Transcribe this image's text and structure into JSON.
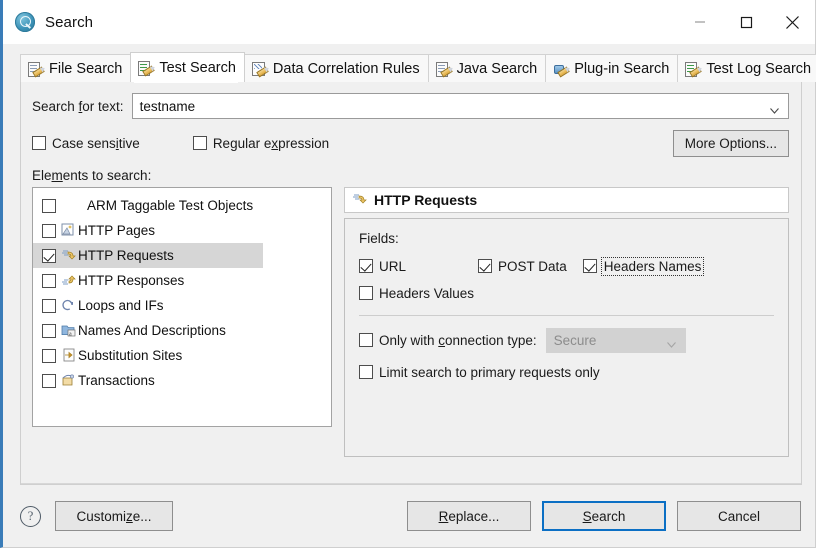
{
  "window": {
    "title": "Search",
    "app_icon": "search-app-icon",
    "controls": {
      "minimize": "minimize-icon",
      "maximize": "maximize-icon",
      "close": "close-icon"
    }
  },
  "tabs": [
    {
      "label": "File Search",
      "icon": "file-search-icon",
      "selected": false
    },
    {
      "label": "Test Search",
      "icon": "test-search-icon",
      "selected": true
    },
    {
      "label": "Data Correlation Rules",
      "icon": "data-correlation-icon",
      "selected": false
    },
    {
      "label": "Java Search",
      "icon": "java-search-icon",
      "selected": false
    },
    {
      "label": "Plug-in Search",
      "icon": "plugin-search-icon",
      "selected": false
    },
    {
      "label": "Test Log Search",
      "icon": "test-log-search-icon",
      "selected": false
    }
  ],
  "search": {
    "label_pre": "Search ",
    "label_mnemonic": "f",
    "label_post": "or text:",
    "value": "testname",
    "placeholder": "",
    "dropdown_icon": "chevron-down-icon"
  },
  "options": {
    "case_sensitive": {
      "pre": "Case sens",
      "mnemonic": "i",
      "post": "tive",
      "checked": false
    },
    "regular_expression": {
      "pre": "Regular e",
      "mnemonic": "x",
      "post": "pression",
      "checked": false
    },
    "more_options": "More Options..."
  },
  "elements": {
    "label_pre": "Ele",
    "label_mnemonic": "m",
    "label_post": "ents to search:",
    "items": [
      {
        "label": "ARM Taggable Test Objects",
        "checked": false,
        "selected": false,
        "icon": "none"
      },
      {
        "label": "HTTP Pages",
        "checked": false,
        "selected": false,
        "icon": "http-pages-icon"
      },
      {
        "label": "HTTP Requests",
        "checked": true,
        "selected": true,
        "icon": "http-requests-icon"
      },
      {
        "label": "HTTP Responses",
        "checked": false,
        "selected": false,
        "icon": "http-responses-icon"
      },
      {
        "label": "Loops and IFs",
        "checked": false,
        "selected": false,
        "icon": "loops-ifs-icon"
      },
      {
        "label": "Names And Descriptions",
        "checked": false,
        "selected": false,
        "icon": "names-descriptions-icon"
      },
      {
        "label": "Substitution Sites",
        "checked": false,
        "selected": false,
        "icon": "substitution-sites-icon"
      },
      {
        "label": "Transactions",
        "checked": false,
        "selected": false,
        "icon": "transactions-icon"
      }
    ]
  },
  "detail": {
    "header": "HTTP Requests",
    "header_icon": "http-requests-icon",
    "fields_label": "Fields:",
    "fields": [
      {
        "label": "URL",
        "checked": true,
        "focused": false
      },
      {
        "label": "POST Data",
        "checked": true,
        "focused": false
      },
      {
        "label": "Headers Names",
        "checked": true,
        "focused": true
      },
      {
        "label": "Headers Values",
        "checked": false,
        "focused": false
      }
    ],
    "connection": {
      "pre": "Only with ",
      "mnemonic": "c",
      "post": "onnection type:",
      "checked": false,
      "select_value": "Secure",
      "select_enabled": false,
      "dropdown_icon": "chevron-down-icon"
    },
    "limit_primary": {
      "label": "Limit search to primary requests only",
      "checked": false
    }
  },
  "footer": {
    "help_icon": "help-icon",
    "customize": {
      "pre": "Customi",
      "mnemonic": "z",
      "post": "e..."
    },
    "replace": {
      "pre": "",
      "mnemonic": "R",
      "post": "eplace..."
    },
    "search": {
      "pre": "",
      "mnemonic": "S",
      "post": "earch"
    },
    "cancel": {
      "pre": "Cancel",
      "mnemonic": "",
      "post": ""
    }
  },
  "colors": {
    "accent": "#0b6fc4",
    "window_border": "#3a7cb8",
    "dialog_bg": "#f0f0f0",
    "selection": "#d6d6d6"
  }
}
